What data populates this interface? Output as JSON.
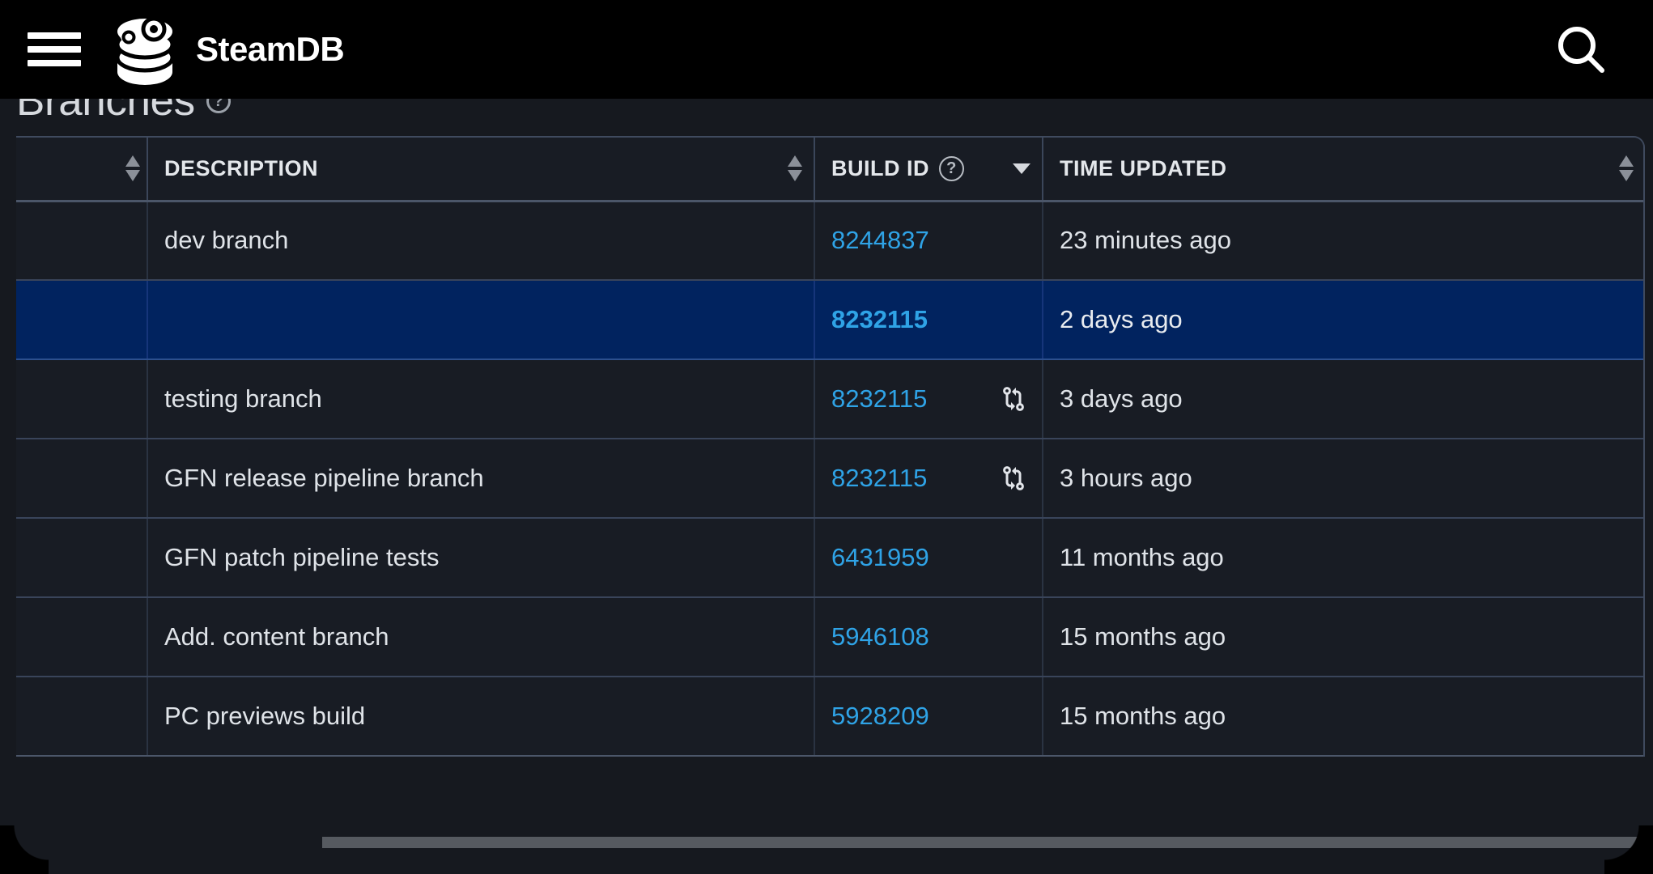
{
  "header": {
    "menu_icon": "hamburger-menu-icon",
    "brand_name": "SteamDB",
    "logo_icon": "steamdb-logo-icon",
    "search_icon": "search-icon"
  },
  "heading": {
    "title": "Branches",
    "help_icon": "question-mark-icon",
    "help_label": "?"
  },
  "table": {
    "columns": [
      {
        "key": "blank",
        "label": "",
        "sort": "both",
        "help": false
      },
      {
        "key": "desc",
        "label": "DESCRIPTION",
        "sort": "both",
        "help": false
      },
      {
        "key": "build",
        "label": "BUILD ID",
        "sort": "desc",
        "help": true,
        "help_label": "?"
      },
      {
        "key": "time",
        "label": "TIME UPDATED",
        "sort": "both",
        "help": false
      }
    ],
    "rows": [
      {
        "description": "dev branch",
        "build_id": "8244837",
        "time_updated": "23 minutes ago",
        "compare_icon": false,
        "selected": false
      },
      {
        "description": "",
        "build_id": "8232115",
        "time_updated": "2 days ago",
        "compare_icon": false,
        "selected": true
      },
      {
        "description": "testing branch",
        "build_id": "8232115",
        "time_updated": "3 days ago",
        "compare_icon": true,
        "selected": false
      },
      {
        "description": "GFN release pipeline branch",
        "build_id": "8232115",
        "time_updated": "3 hours ago",
        "compare_icon": true,
        "selected": false
      },
      {
        "description": "GFN patch pipeline tests",
        "build_id": "6431959",
        "time_updated": "11 months ago",
        "compare_icon": false,
        "selected": false
      },
      {
        "description": "Add. content branch",
        "build_id": "5946108",
        "time_updated": "15 months ago",
        "compare_icon": false,
        "selected": false
      },
      {
        "description": "PC previews build",
        "build_id": "5928209",
        "time_updated": "15 months ago",
        "compare_icon": false,
        "selected": false
      }
    ],
    "compare_icon_name": "git-compare-icon"
  },
  "scrollbar": {
    "orientation": "horizontal",
    "thumb_name": "horizontal-scrollbar-thumb"
  },
  "colors": {
    "page_background": "#16191f",
    "header_background": "#000000",
    "row_background": "#181c24",
    "selected_row_background": "#01235f",
    "link_blue": "#2fa3e6",
    "border": "#39445a",
    "text": "#dfe3e8",
    "scrollbar_thumb": "#565a60"
  }
}
